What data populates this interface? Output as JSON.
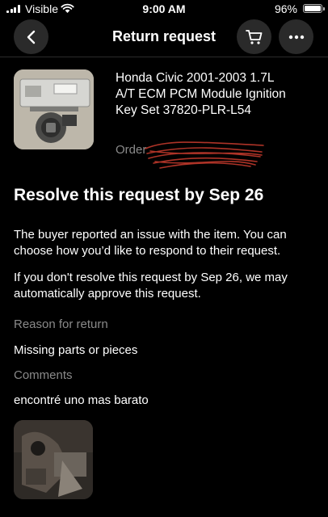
{
  "status_bar": {
    "carrier": "Visible",
    "time": "9:00 AM",
    "battery": "96%"
  },
  "header": {
    "title": "Return request",
    "back_icon": "chevron-left-icon",
    "cart_icon": "cart-icon",
    "more_icon": "ellipsis-icon"
  },
  "item": {
    "title": "Honda Civic 2001-2003 1.7L A/T ECM PCM Module Ignition Key Set 37820-PLR-L54",
    "order_label": "Order"
  },
  "resolve": {
    "heading": "Resolve this request by Sep 26",
    "paragraph1": "The buyer reported an issue with the item. You can choose how you’d like to respond to their request.",
    "paragraph2": "If you don't resolve this request by Sep 26, we may automatically approve this request."
  },
  "details": {
    "reason_label": "Reason for return",
    "reason_value": "Missing parts or pieces",
    "comments_label": "Comments",
    "comments_value": "encontré uno mas barato"
  },
  "colors": {
    "background": "#000000",
    "muted_text": "#8a8a8a",
    "button_bg": "#2a2a2a",
    "redaction": "#c0392b"
  }
}
